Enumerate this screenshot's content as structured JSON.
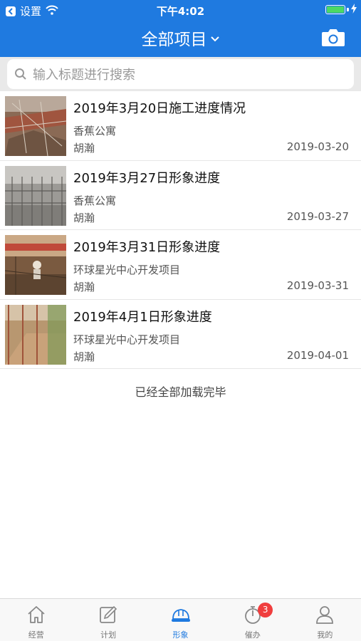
{
  "status_bar": {
    "back_label": "设置",
    "time": "下午4:02",
    "battery_level": 1.0
  },
  "nav": {
    "title": "全部项目",
    "title_icon": "chevron-down-icon",
    "action_icon": "camera-icon"
  },
  "search": {
    "placeholder": "输入标题进行搜索",
    "icon": "search-icon"
  },
  "records": [
    {
      "title": "2019年3月20日施工进度情况",
      "project": "香蕉公寓",
      "author": "胡瀚",
      "date": "2019-03-20"
    },
    {
      "title": "2019年3月27日形象进度",
      "project": "香蕉公寓",
      "author": "胡瀚",
      "date": "2019-03-27"
    },
    {
      "title": "2019年3月31日形象进度",
      "project": "环球星光中心开发项目",
      "author": "胡瀚",
      "date": "2019-03-31"
    },
    {
      "title": "2019年4月1日形象进度",
      "project": "环球星光中心开发项目",
      "author": "胡瀚",
      "date": "2019-04-01"
    }
  ],
  "list_footer": "已经全部加载完毕",
  "tabs": [
    {
      "label": "经营",
      "icon": "home-icon",
      "active": false
    },
    {
      "label": "计划",
      "icon": "edit-icon",
      "active": false
    },
    {
      "label": "形象",
      "icon": "hard-hat-icon",
      "active": true
    },
    {
      "label": "催办",
      "icon": "timer-icon",
      "active": false,
      "badge": "3"
    },
    {
      "label": "我的",
      "icon": "user-icon",
      "active": false
    }
  ],
  "colors": {
    "primary": "#1f7ae0",
    "badge": "#f03e3e",
    "battery": "#4cd964"
  }
}
